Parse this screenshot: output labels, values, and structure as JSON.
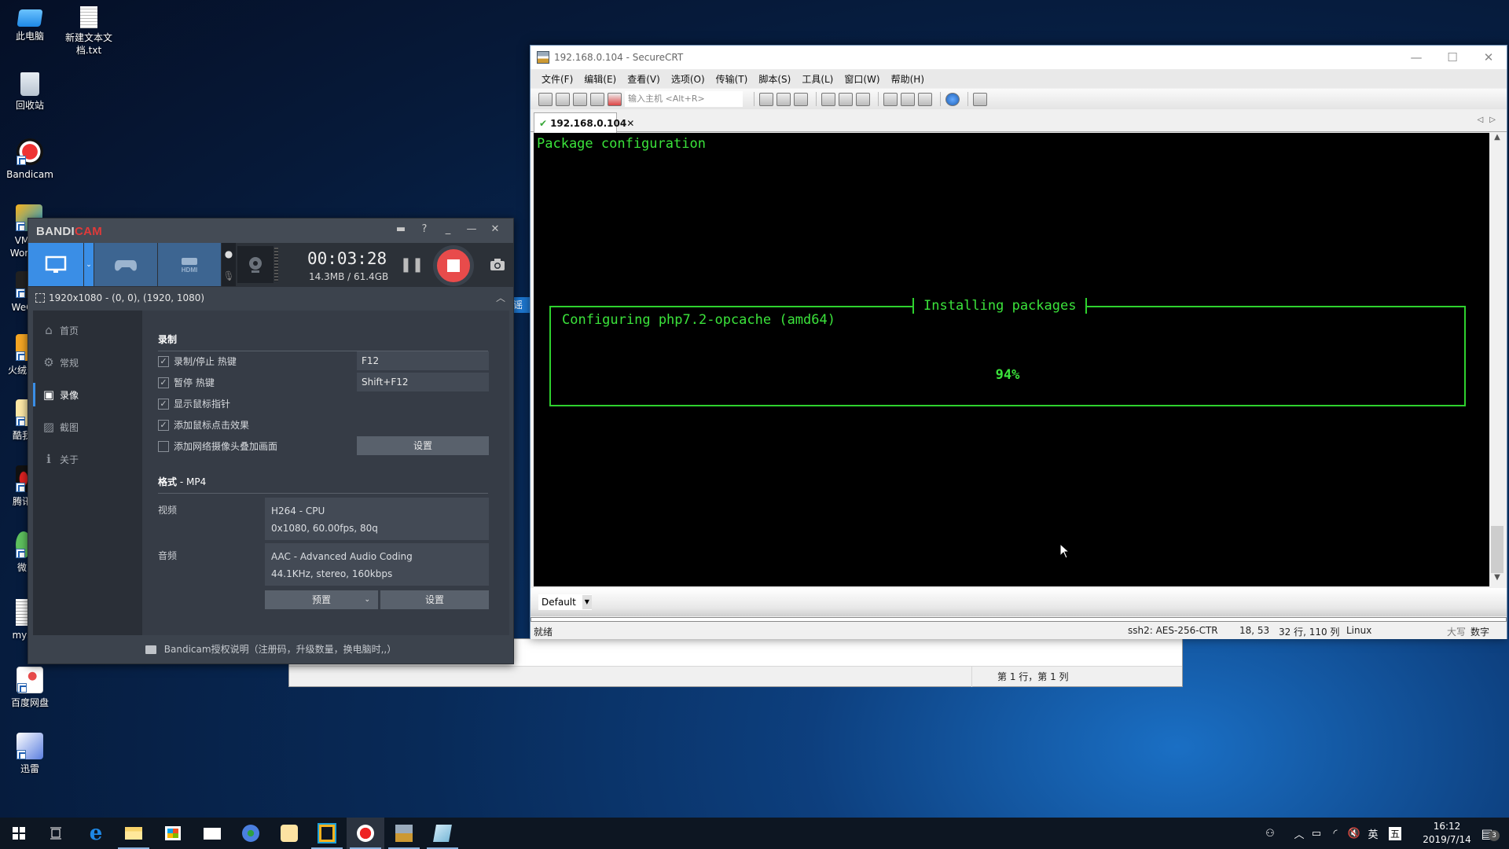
{
  "desktop": {
    "icons": [
      {
        "label": "此电脑",
        "icon": "computer-icon"
      },
      {
        "label": "新建文本文\n档.txt",
        "icon": "text-file-icon"
      },
      {
        "label": "回收站",
        "icon": "recycle-bin-icon"
      },
      {
        "label": "Bandicam",
        "icon": "bandicam-icon"
      },
      {
        "label": "VM\nWork",
        "icon": "vmware-icon"
      },
      {
        "label": "WeC",
        "icon": "wechat-devtools-icon"
      },
      {
        "label": "火绒安",
        "icon": "huorong-icon"
      },
      {
        "label": "酷我",
        "icon": "kuwo-icon"
      },
      {
        "label": "腾讯",
        "icon": "qq-icon"
      },
      {
        "label": "微",
        "icon": "wechat-icon"
      },
      {
        "label": "mys",
        "icon": "mysql-file-icon"
      },
      {
        "label": "百度网盘",
        "icon": "baidu-netdisk-icon"
      },
      {
        "label": "迅雷",
        "icon": "xunlei-icon"
      }
    ],
    "ime_sliver_text": "谣呢"
  },
  "notepad": {
    "status_position": "第 1 行，第 1 列"
  },
  "securecrt": {
    "title": "192.168.0.104 - SecureCRT",
    "menu": [
      "文件(F)",
      "编辑(E)",
      "查看(V)",
      "选项(O)",
      "传输(T)",
      "脚本(S)",
      "工具(L)",
      "窗口(W)",
      "帮助(H)"
    ],
    "quick_connect_placeholder": "输入主机 <Alt+R>",
    "tab": {
      "label": "192.168.0.104",
      "connected": true
    },
    "terminal": {
      "header_line": "Package configuration",
      "dialog_title": "Installing packages",
      "dialog_message": "Configuring php7.2-opcache (amd64)",
      "progress_text": "94%",
      "progress": 0.94,
      "text_color": "#3be33b"
    },
    "session_dropdown": "Default",
    "status": {
      "ready": "就绪",
      "cipher": "ssh2: AES-256-CTR",
      "cursor": "18,  53",
      "size": "32 行, 110 列",
      "os": "Linux",
      "caps": "大写",
      "num": "数字"
    }
  },
  "bandicam": {
    "logo_a": "BANDI",
    "logo_b": "CAM",
    "timer": "00:03:28",
    "size": "14.3MB / 61.4GB",
    "region": "1920x1080 - (0, 0), (1920, 1080)",
    "sidebar": [
      {
        "label": "首页",
        "icon": "home-icon"
      },
      {
        "label": "常规",
        "icon": "gear-icon"
      },
      {
        "label": "录像",
        "icon": "video-settings-icon",
        "active": true
      },
      {
        "label": "截图",
        "icon": "screenshot-settings-icon"
      },
      {
        "label": "关于",
        "icon": "info-icon"
      }
    ],
    "record_section": "录制",
    "options": [
      {
        "label": "录制/停止 热键",
        "checked": true,
        "value": "F12"
      },
      {
        "label": "暂停 热键",
        "checked": true,
        "value": "Shift+F12"
      },
      {
        "label": "显示鼠标指针",
        "checked": true
      },
      {
        "label": "添加鼠标点击效果",
        "checked": true
      },
      {
        "label": "添加网络摄像头叠加画面",
        "checked": false
      }
    ],
    "settings_label": "设置",
    "format_title": "格式",
    "format_value": " - MP4",
    "video_label": "视频",
    "video_line1": "H264 - CPU",
    "video_line2": "0x1080, 60.00fps, 80q",
    "audio_label": "音频",
    "audio_line1": "AAC - Advanced Audio Coding",
    "audio_line2": "44.1KHz, stereo, 160kbps",
    "preset_label": "预置",
    "footer": "Bandicam授权说明（注册码，升级数量，换电脑时,,）",
    "accent": "#3a8ee6",
    "record_color": "#e84b4b"
  },
  "taskbar": {
    "apps": [
      "start",
      "task-view",
      "edge",
      "file-explorer",
      "store",
      "mail",
      "chrome",
      "kuwo",
      "vmware",
      "bandicam",
      "securecrt",
      "notepad"
    ],
    "tray": {
      "ime_lang": "英",
      "ime_mode": "五",
      "time": "16:12",
      "date": "2019/7/14",
      "notifications": "3"
    }
  }
}
